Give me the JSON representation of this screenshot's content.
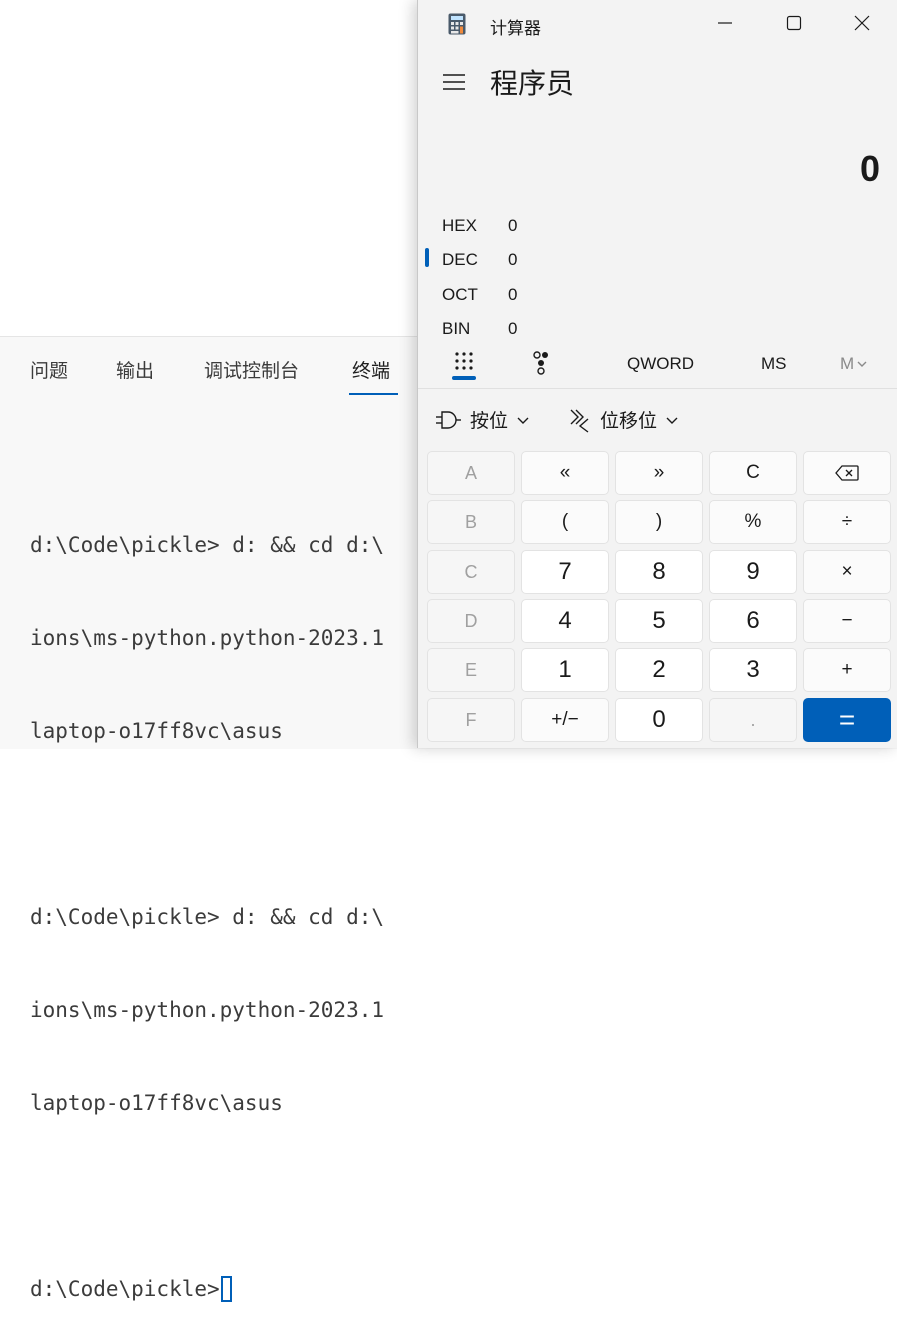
{
  "panel": {
    "tabs": [
      "问题",
      "输出",
      "调试控制台",
      "终端"
    ],
    "active_tab": "终端",
    "terminal_lines": [
      "",
      "d:\\Code\\pickle> d: && cd d:\\",
      "ions\\ms-python.python-2023.1",
      "laptop-o17ff8vc\\asus",
      "",
      "d:\\Code\\pickle> d: && cd d:\\",
      "ions\\ms-python.python-2023.1",
      "laptop-o17ff8vc\\asus",
      "",
      "d:\\Code\\pickle>"
    ]
  },
  "calculator": {
    "window_title": "计算器",
    "window_controls": [
      "minimize-icon",
      "maximize-icon",
      "close-icon"
    ],
    "mode": "程序员",
    "display_value": "0",
    "radix": [
      {
        "label": "HEX",
        "value": "0"
      },
      {
        "label": "DEC",
        "value": "0"
      },
      {
        "label": "OCT",
        "value": "0"
      },
      {
        "label": "BIN",
        "value": "0"
      }
    ],
    "active_radix": "DEC",
    "modebar": {
      "word_size": "QWORD",
      "memory_store": "MS",
      "memory_menu": "M"
    },
    "bitwise_label": "按位",
    "bitshift_label": "位移位",
    "accent": "#005fb8",
    "keys": [
      [
        "A",
        "«",
        "»",
        "C",
        "backspace-icon"
      ],
      [
        "B",
        "(",
        ")",
        "%",
        "÷"
      ],
      [
        "C",
        "7",
        "8",
        "9",
        "×"
      ],
      [
        "D",
        "4",
        "5",
        "6",
        "−"
      ],
      [
        "E",
        "1",
        "2",
        "3",
        "+"
      ],
      [
        "F",
        "+/−",
        "0",
        ".",
        "="
      ]
    ]
  }
}
